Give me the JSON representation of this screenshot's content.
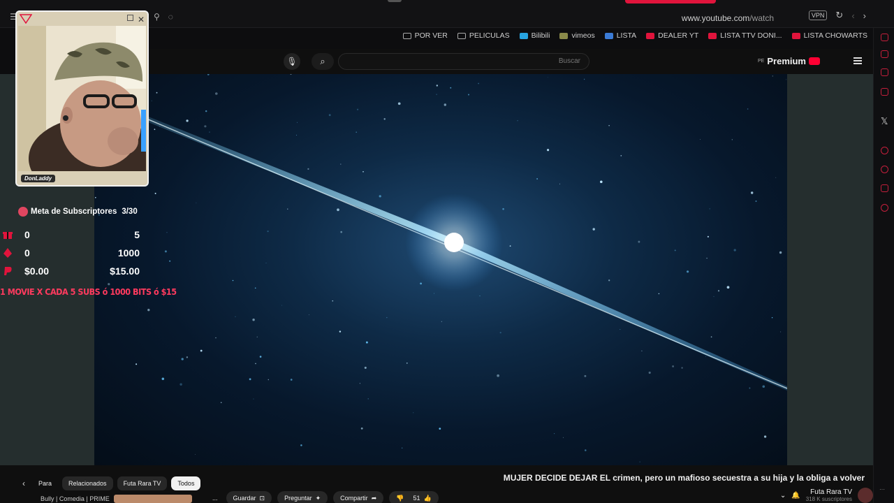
{
  "browser": {
    "url_domain": "www.youtube.com",
    "url_path": "/watch",
    "vpn_label": "VPN"
  },
  "bookmarks": [
    {
      "label": "LISTA CHOWARTS",
      "icon": "youtube-icon"
    },
    {
      "label": "LISTA TTV DONI...",
      "icon": "youtube-icon"
    },
    {
      "label": "DEALER YT",
      "icon": "youtube-icon"
    },
    {
      "label": "LISTA",
      "icon": "blue-circle-icon"
    },
    {
      "label": "vimeos",
      "icon": "x-icon"
    },
    {
      "label": "Bilibili",
      "icon": "bilibili-icon"
    },
    {
      "label": "PELICULAS",
      "icon": "folder-icon"
    },
    {
      "label": "POR VER",
      "icon": "folder-icon"
    }
  ],
  "youtube": {
    "logo_text": "Premium",
    "logo_sup": "PE",
    "search_placeholder": "Buscar"
  },
  "webcam": {
    "streamer_name": "DonLaddy"
  },
  "goal": {
    "title": "Meta de Subscriptores",
    "progress": "3/30",
    "rows": [
      {
        "icon": "gift-icon",
        "current": "0",
        "target": "5"
      },
      {
        "icon": "bits-icon",
        "current": "0",
        "target": "1000"
      },
      {
        "icon": "paypal-icon",
        "current": "$0.00",
        "target": "$15.00"
      }
    ],
    "banner": "1 MOVIE X CADA 5 SUBS ó 1000 BITS ó $15"
  },
  "video": {
    "title": "MUJER DECIDE DEJAR EL crimen, pero un mafioso secuestra a su hija y la obliga a volver"
  },
  "channel": {
    "name": "Futa Rara TV",
    "subscribers": "318 K suscriptores"
  },
  "actions": {
    "likes": "51",
    "share": "Compartir",
    "ask": "Preguntar",
    "save": "Guardar",
    "more": "..."
  },
  "chips": [
    "Todos",
    "Futa Rara TV",
    "Relacionados",
    "Para"
  ],
  "recommended_snippet": "Bully | Comedia | PRIME"
}
